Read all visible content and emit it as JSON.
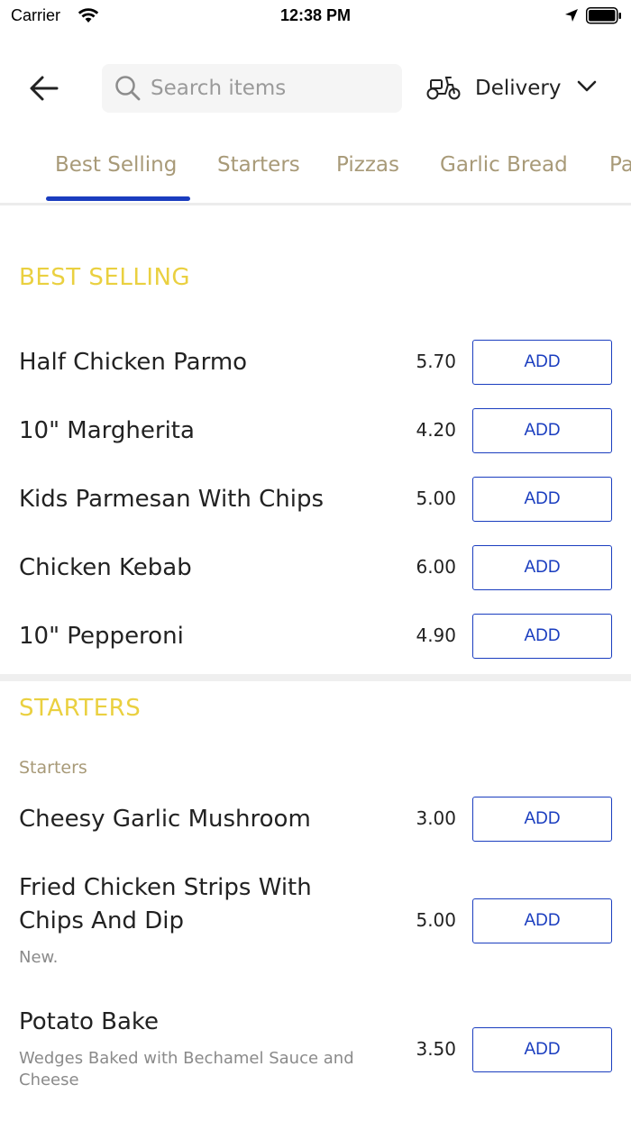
{
  "status_bar": {
    "carrier": "Carrier",
    "time": "12:38 PM"
  },
  "header": {
    "search": {
      "placeholder": "Search items"
    },
    "delivery": {
      "label": "Delivery"
    }
  },
  "tabs": [
    {
      "label": "Best Selling",
      "active": true
    },
    {
      "label": "Starters",
      "active": false
    },
    {
      "label": "Pizzas",
      "active": false
    },
    {
      "label": "Garlic Bread",
      "active": false
    },
    {
      "label": "Pa",
      "active": false
    }
  ],
  "sections": {
    "best_selling": {
      "title": "BEST SELLING",
      "items": [
        {
          "name": "Half Chicken Parmo",
          "price": "5.70",
          "button": "ADD"
        },
        {
          "name": "10\" Margherita",
          "price": "4.20",
          "button": "ADD"
        },
        {
          "name": "Kids Parmesan With Chips",
          "price": "5.00",
          "button": "ADD"
        },
        {
          "name": "Chicken Kebab",
          "price": "6.00",
          "button": "ADD"
        },
        {
          "name": "10\" Pepperoni",
          "price": "4.90",
          "button": "ADD"
        }
      ]
    },
    "starters": {
      "title": "STARTERS",
      "subcategory": "Starters",
      "items": [
        {
          "name": "Cheesy Garlic Mushroom",
          "price": "3.00",
          "button": "ADD"
        },
        {
          "name_line1": "Fried Chicken Strips With",
          "name_line2": "Chips And Dip",
          "description": "New.",
          "price": "5.00",
          "button": "ADD"
        },
        {
          "name": "Potato Bake",
          "desc_line1": "Wedges Baked with Bechamel Sauce and",
          "desc_line2": "Cheese",
          "price": "3.50",
          "button": "ADD"
        }
      ]
    }
  },
  "colors": {
    "accent": "#1a3dbf",
    "section_title": "#ead040",
    "tab_text": "#a89a78"
  },
  "icons": [
    "wifi-icon",
    "location-arrow-icon",
    "battery-icon",
    "back-arrow-icon",
    "search-icon",
    "scooter-icon",
    "chevron-down-icon"
  ]
}
